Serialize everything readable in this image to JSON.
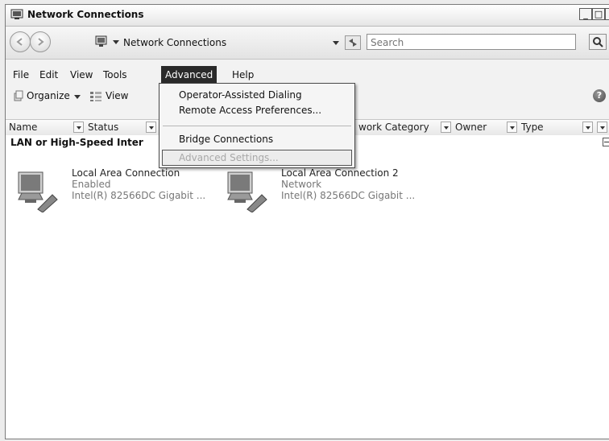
{
  "window": {
    "title": "Network Connections"
  },
  "address": {
    "path": "Network Connections",
    "search_placeholder": "Search"
  },
  "menubar": {
    "items": [
      "File",
      "Edit",
      "View",
      "Tools",
      "Advanced",
      "Help"
    ],
    "active": "Advanced"
  },
  "toolbar": {
    "organize": "Organize",
    "views": "View"
  },
  "columns": [
    "Name",
    "Status",
    "work Category",
    "Owner",
    "Type"
  ],
  "group": {
    "title": "LAN or High-Speed Inter"
  },
  "connections": [
    {
      "name": "Local Area Connection",
      "status": "Enabled",
      "device": "Intel(R) 82566DC Gigabit ..."
    },
    {
      "name": "Local Area Connection 2",
      "status": "Network",
      "device": "Intel(R) 82566DC Gigabit ..."
    }
  ],
  "advanced_menu": [
    {
      "label": "Operator-Assisted Dialing",
      "enabled": true
    },
    {
      "label": "Remote Access Preferences...",
      "enabled": true
    },
    {
      "label": "Bridge Connections",
      "enabled": true
    },
    {
      "label": "Advanced Settings...",
      "enabled": false
    }
  ]
}
